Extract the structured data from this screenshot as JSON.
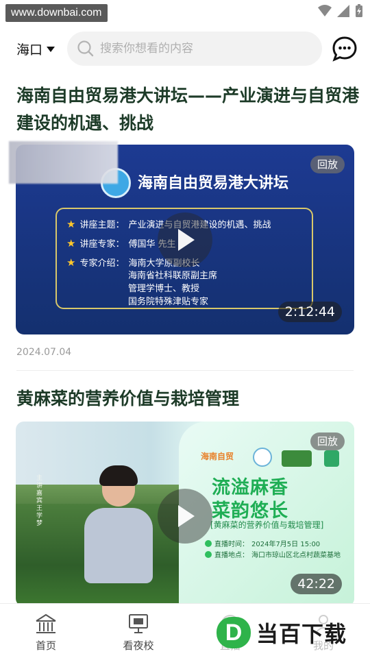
{
  "status_bar": {
    "watermark": "www.downbai.com"
  },
  "header": {
    "city": "海口",
    "search_placeholder": "搜索你想看的内容"
  },
  "articles": [
    {
      "title": "海南自由贸易港大讲坛——产业演进与自贸港建设的机遇、挑战",
      "badge": "回放",
      "duration": "2:12:44",
      "date": "2024.07.04",
      "thumb": {
        "heading": "海南自由贸易港大讲坛",
        "lines": [
          {
            "label": "讲座主题：",
            "value": "产业演进与自贸港建设的机遇、挑战"
          },
          {
            "label": "讲座专家：",
            "value": "傅国华  先生"
          },
          {
            "label": "专家介绍：",
            "value": "海南大学原副校长"
          }
        ],
        "extra_lines": [
          "海南省社科联原副主席",
          "管理学博士、教授",
          "国务院特殊津贴专家"
        ]
      }
    },
    {
      "title": "黄麻菜的营养价值与栽培管理",
      "badge": "回放",
      "duration": "42:22",
      "thumb": {
        "brand": "海南自贸",
        "slogan1": "流溢麻香",
        "slogan2": "菜韵悠长",
        "subtitle": "[黄麻菜的营养价值与栽培管理]",
        "time_label": "直播时间：",
        "time_value": "2024年7月5日 15:00",
        "place_label": "直播地点：",
        "place_value": "海口市琼山区北点村蔬菜基地",
        "vertical_text": "主讲嘉宾 王学梦"
      }
    }
  ],
  "bottom_nav": {
    "items": [
      {
        "label": "首页",
        "icon": "home-icon"
      },
      {
        "label": "看夜校",
        "icon": "monitor-icon"
      },
      {
        "label": "直播",
        "icon": "live-icon"
      },
      {
        "label": "我的",
        "icon": "user-icon"
      }
    ]
  },
  "corner_watermark": {
    "logo": "D",
    "text": "当百下载"
  }
}
